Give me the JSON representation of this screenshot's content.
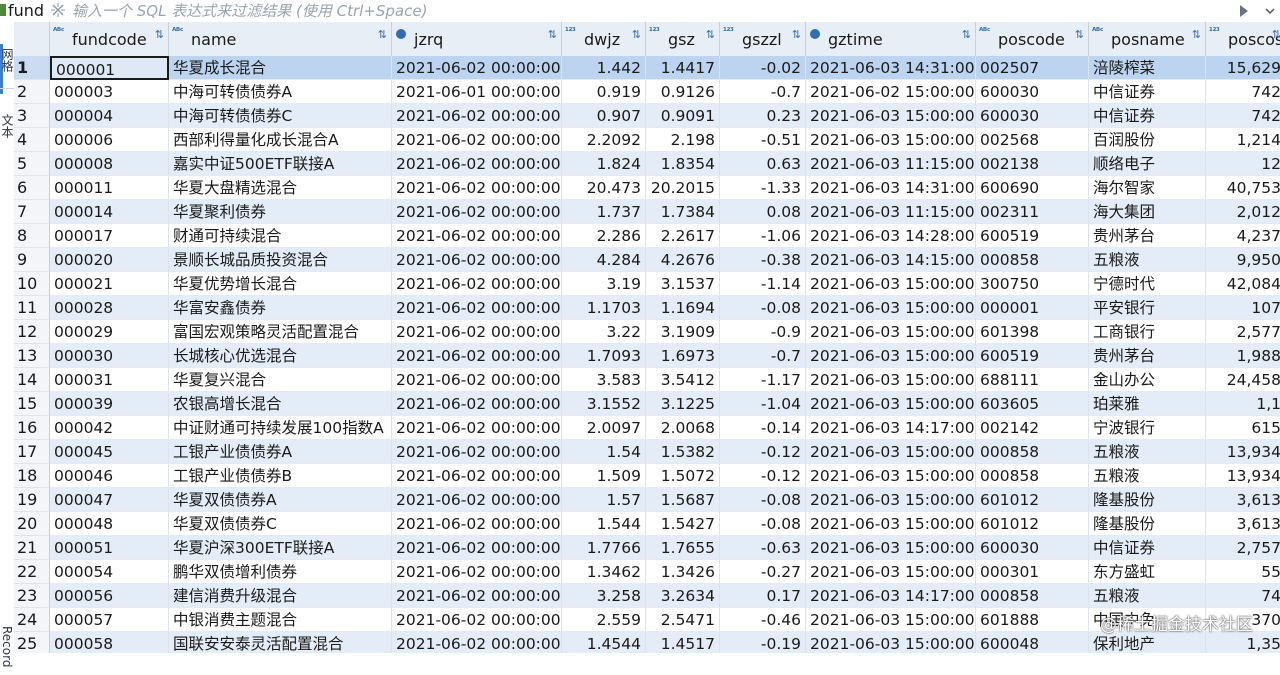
{
  "table_name": "fund",
  "filter": {
    "placeholder": "输入一个 SQL 表达式来过滤结果 (使用 Ctrl+Space)"
  },
  "side_tabs": [
    "网格",
    "文本",
    "Record"
  ],
  "columns": [
    {
      "name": "fundcode",
      "type": "ABC"
    },
    {
      "name": "name",
      "type": "ABC"
    },
    {
      "name": "jzrq",
      "type": "clock"
    },
    {
      "name": "dwjz",
      "type": "123"
    },
    {
      "name": "gsz",
      "type": "123"
    },
    {
      "name": "gszzl",
      "type": "123"
    },
    {
      "name": "gztime",
      "type": "clock"
    },
    {
      "name": "poscode",
      "type": "ABC"
    },
    {
      "name": "posname",
      "type": "ABC"
    },
    {
      "name": "poscos",
      "type": "123"
    }
  ],
  "rows": [
    [
      "000001",
      "华夏成长混合",
      "2021-06-02 00:00:00",
      "1.442",
      "1.4417",
      "-0.02",
      "2021-06-03 14:31:00",
      "002507",
      "涪陵榨菜",
      "15,629"
    ],
    [
      "000003",
      "中海可转债债券A",
      "2021-06-01 00:00:00",
      "0.919",
      "0.9126",
      "-0.7",
      "2021-06-02 15:00:00",
      "600030",
      "中信证券",
      "742"
    ],
    [
      "000004",
      "中海可转债债券C",
      "2021-06-02 00:00:00",
      "0.907",
      "0.9091",
      "0.23",
      "2021-06-03 15:00:00",
      "600030",
      "中信证券",
      "742"
    ],
    [
      "000006",
      "西部利得量化成长混合A",
      "2021-06-02 00:00:00",
      "2.2092",
      "2.198",
      "-0.51",
      "2021-06-03 15:00:00",
      "002568",
      "百润股份",
      "1,214"
    ],
    [
      "000008",
      "嘉实中证500ETF联接A",
      "2021-06-02 00:00:00",
      "1.824",
      "1.8354",
      "0.63",
      "2021-06-03 11:15:00",
      "002138",
      "顺络电子",
      "12"
    ],
    [
      "000011",
      "华夏大盘精选混合",
      "2021-06-02 00:00:00",
      "20.473",
      "20.2015",
      "-1.33",
      "2021-06-03 14:31:00",
      "600690",
      "海尔智家",
      "40,753"
    ],
    [
      "000014",
      "华夏聚利债券",
      "2021-06-02 00:00:00",
      "1.737",
      "1.7384",
      "0.08",
      "2021-06-03 11:15:00",
      "002311",
      "海大集团",
      "2,012"
    ],
    [
      "000017",
      "财通可持续混合",
      "2021-06-02 00:00:00",
      "2.286",
      "2.2617",
      "-1.06",
      "2021-06-03 14:28:00",
      "600519",
      "贵州茅台",
      "4,237"
    ],
    [
      "000020",
      "景顺长城品质投资混合",
      "2021-06-02 00:00:00",
      "4.284",
      "4.2676",
      "-0.38",
      "2021-06-03 14:15:00",
      "000858",
      "五粮液",
      "9,950"
    ],
    [
      "000021",
      "华夏优势增长混合",
      "2021-06-02 00:00:00",
      "3.19",
      "3.1537",
      "-1.14",
      "2021-06-03 15:00:00",
      "300750",
      "宁德时代",
      "42,084"
    ],
    [
      "000028",
      "华富安鑫债券",
      "2021-06-02 00:00:00",
      "1.1703",
      "1.1694",
      "-0.08",
      "2021-06-03 15:00:00",
      "000001",
      "平安银行",
      "107"
    ],
    [
      "000029",
      "富国宏观策略灵活配置混合",
      "2021-06-02 00:00:00",
      "3.22",
      "3.1909",
      "-0.9",
      "2021-06-03 15:00:00",
      "601398",
      "工商银行",
      "2,577"
    ],
    [
      "000030",
      "长城核心优选混合",
      "2021-06-02 00:00:00",
      "1.7093",
      "1.6973",
      "-0.7",
      "2021-06-03 15:00:00",
      "600519",
      "贵州茅台",
      "1,988"
    ],
    [
      "000031",
      "华夏复兴混合",
      "2021-06-02 00:00:00",
      "3.583",
      "3.5412",
      "-1.17",
      "2021-06-03 15:00:00",
      "688111",
      "金山办公",
      "24,458"
    ],
    [
      "000039",
      "农银高增长混合",
      "2021-06-02 00:00:00",
      "3.1552",
      "3.1225",
      "-1.04",
      "2021-06-03 15:00:00",
      "603605",
      "珀莱雅",
      "1,1"
    ],
    [
      "000042",
      "中证财通可持续发展100指数A",
      "2021-06-02 00:00:00",
      "2.0097",
      "2.0068",
      "-0.14",
      "2021-06-03 14:17:00",
      "002142",
      "宁波银行",
      "615"
    ],
    [
      "000045",
      "工银产业债债券A",
      "2021-06-02 00:00:00",
      "1.54",
      "1.5382",
      "-0.12",
      "2021-06-03 15:00:00",
      "000858",
      "五粮液",
      "13,934"
    ],
    [
      "000046",
      "工银产业债债券B",
      "2021-06-02 00:00:00",
      "1.509",
      "1.5072",
      "-0.12",
      "2021-06-03 15:00:00",
      "000858",
      "五粮液",
      "13,934"
    ],
    [
      "000047",
      "华夏双债债券A",
      "2021-06-02 00:00:00",
      "1.57",
      "1.5687",
      "-0.08",
      "2021-06-03 15:00:00",
      "601012",
      "隆基股份",
      "3,613"
    ],
    [
      "000048",
      "华夏双债债券C",
      "2021-06-02 00:00:00",
      "1.544",
      "1.5427",
      "-0.08",
      "2021-06-03 15:00:00",
      "601012",
      "隆基股份",
      "3,613"
    ],
    [
      "000051",
      "华夏沪深300ETF联接A",
      "2021-06-02 00:00:00",
      "1.7766",
      "1.7655",
      "-0.63",
      "2021-06-03 15:00:00",
      "600030",
      "中信证券",
      "2,757"
    ],
    [
      "000054",
      "鹏华双债增利债券",
      "2021-06-02 00:00:00",
      "1.3462",
      "1.3426",
      "-0.27",
      "2021-06-03 15:00:00",
      "000301",
      "东方盛虹",
      "55"
    ],
    [
      "000056",
      "建信消费升级混合",
      "2021-06-02 00:00:00",
      "3.258",
      "3.2634",
      "0.17",
      "2021-06-03 14:17:00",
      "000858",
      "五粮液",
      "74"
    ],
    [
      "000057",
      "中银消费主题混合",
      "2021-06-02 00:00:00",
      "2.559",
      "2.5471",
      "-0.46",
      "2021-06-03 15:00:00",
      "601888",
      "中国中免",
      "370"
    ],
    [
      "000058",
      "国联安安泰灵活配置混合",
      "2021-06-02 00:00:00",
      "1.4544",
      "1.4517",
      "-0.19",
      "2021-06-03 15:00:00",
      "600048",
      "保利地产",
      "1,35"
    ]
  ],
  "watermark": "@稀土掘金技术社区"
}
